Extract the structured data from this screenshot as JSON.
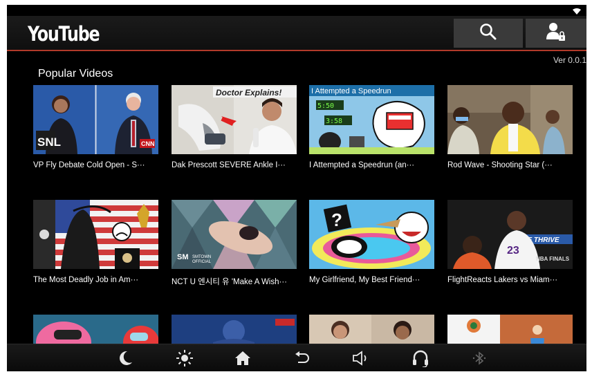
{
  "app": {
    "logo_text": "YouTube",
    "version": "Ver 0.0.1",
    "accent_color": "#b23a2a"
  },
  "header": {
    "search_icon": "search-icon",
    "account_icon": "user-lock-icon"
  },
  "section": {
    "title": "Popular Videos"
  },
  "videos": [
    {
      "title": "VP Fly Debate Cold Open - S···"
    },
    {
      "title": "Dak Prescott SEVERE Ankle I···",
      "badge": "Doctor Explains!"
    },
    {
      "title": "I Attempted a Speedrun (an···",
      "badge": "I Attempted a Speedrun"
    },
    {
      "title": "Rod Wave - Shooting Star (···"
    },
    {
      "title": "The Most Deadly Job in Am···"
    },
    {
      "title": "NCT U 엔시티 유 'Make A Wish···"
    },
    {
      "title": "My Girlfriend, My Best Friend···"
    },
    {
      "title": "FlightReacts Lakers vs Miam···"
    },
    {
      "title": ""
    },
    {
      "title": ""
    },
    {
      "title": ""
    },
    {
      "title": ""
    }
  ],
  "navbar": {
    "icons": [
      "moon-icon",
      "brightness-icon",
      "home-icon",
      "back-icon",
      "volume-icon",
      "headset-icon",
      "bluetooth-icon"
    ]
  }
}
